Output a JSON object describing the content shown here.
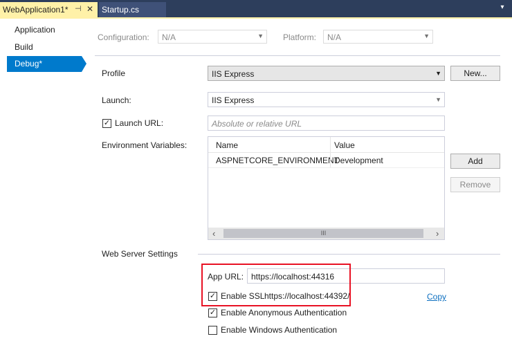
{
  "tabs": {
    "active": {
      "label": "WebApplication1*",
      "pin": "⊣",
      "close": "✕"
    },
    "inactive": {
      "label": "Startup.cs"
    },
    "overflow": "▾"
  },
  "nav": {
    "items": [
      {
        "label": "Application"
      },
      {
        "label": "Build"
      },
      {
        "label": "Debug*"
      }
    ]
  },
  "config": {
    "configuration_label": "Configuration:",
    "configuration_value": "N/A",
    "platform_label": "Platform:",
    "platform_value": "N/A"
  },
  "profile": {
    "label": "Profile",
    "value": "IIS Express",
    "new_button": "New..."
  },
  "launch": {
    "label": "Launch:",
    "value": "IIS Express"
  },
  "launch_url": {
    "label": "Launch URL:",
    "checked": true,
    "placeholder": "Absolute or relative URL"
  },
  "env": {
    "label": "Environment Variables:",
    "columns": [
      "Name",
      "Value"
    ],
    "rows": [
      {
        "name": "ASPNETCORE_ENVIRONMENT",
        "value": "Development"
      }
    ],
    "add_button": "Add",
    "remove_button": "Remove",
    "scroll_left": "‹",
    "scroll_right": "›",
    "thumb_grip": "III"
  },
  "web_server": {
    "section_label": "Web Server Settings",
    "app_url_label": "App URL:",
    "app_url_value": "https://localhost:44316",
    "enable_ssl_label": "Enable SSL",
    "enable_ssl_checked": true,
    "ssl_url": "https://localhost:44392/",
    "copy_link": "Copy",
    "anon_auth_label": "Enable Anonymous Authentication",
    "anon_auth_checked": true,
    "windows_auth_label": "Enable Windows Authentication",
    "windows_auth_checked": false
  },
  "colors": {
    "accent": "#007acc",
    "tab_active": "#fff1a8",
    "highlight_box": "#e81123"
  }
}
